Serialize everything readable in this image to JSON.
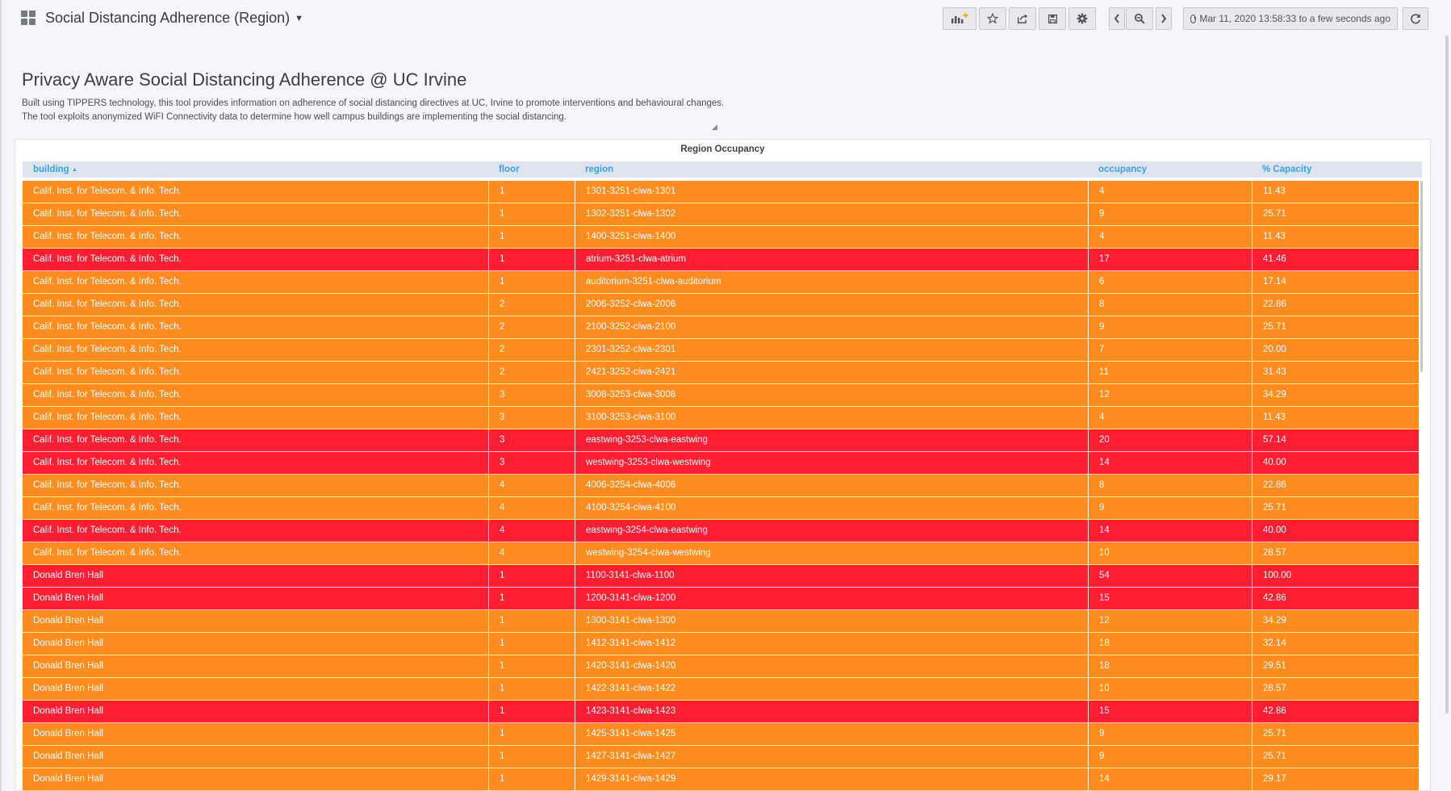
{
  "header": {
    "dashboard_title": "Social Distancing Adherence (Region)",
    "time_range": "Mar 11, 2020 13:58:33 to a few seconds ago",
    "icons": [
      "apps-grid-icon",
      "add-panel-icon",
      "star-icon",
      "share-icon",
      "save-icon",
      "settings-icon",
      "chevron-left-icon",
      "zoom-out-icon",
      "chevron-right-icon",
      "clock-icon",
      "refresh-icon"
    ]
  },
  "text_panel": {
    "heading": "Privacy Aware Social Distancing Adherence @ UC Irvine",
    "description": "Built using TIPPERS technology, this tool provides information on adherence of social distancing directives at UC, Irvine to promote interventions and behavioural changes. The tool exploits anonymized WiFI Connectivity data to determine how well campus buildings are implementing the social distancing."
  },
  "table": {
    "title": "Region Occupancy",
    "columns": [
      "building",
      "floor",
      "region",
      "occupancy",
      "% Capacity"
    ],
    "sort_indicator": "▲",
    "colors": {
      "orange": "#ff8c1e",
      "red": "#ff1e32",
      "header_text": "#33a2e5"
    },
    "rows": [
      {
        "building": "Calif. Inst. for Telecom. & Info. Tech.",
        "floor": "1",
        "region": "1301-3251-clwa-1301",
        "occupancy": "4",
        "capacity": "11.43",
        "status": "orange"
      },
      {
        "building": "Calif. Inst. for Telecom. & Info. Tech.",
        "floor": "1",
        "region": "1302-3251-clwa-1302",
        "occupancy": "9",
        "capacity": "25.71",
        "status": "orange"
      },
      {
        "building": "Calif. Inst. for Telecom. & Info. Tech.",
        "floor": "1",
        "region": "1400-3251-clwa-1400",
        "occupancy": "4",
        "capacity": "11.43",
        "status": "orange"
      },
      {
        "building": "Calif. Inst. for Telecom. & Info. Tech.",
        "floor": "1",
        "region": "atrium-3251-clwa-atrium",
        "occupancy": "17",
        "capacity": "41.46",
        "status": "red"
      },
      {
        "building": "Calif. Inst. for Telecom. & Info. Tech.",
        "floor": "1",
        "region": "auditorium-3251-clwa-auditorium",
        "occupancy": "6",
        "capacity": "17.14",
        "status": "orange"
      },
      {
        "building": "Calif. Inst. for Telecom. & Info. Tech.",
        "floor": "2",
        "region": "2006-3252-clwa-2006",
        "occupancy": "8",
        "capacity": "22.86",
        "status": "orange"
      },
      {
        "building": "Calif. Inst. for Telecom. & Info. Tech.",
        "floor": "2",
        "region": "2100-3252-clwa-2100",
        "occupancy": "9",
        "capacity": "25.71",
        "status": "orange"
      },
      {
        "building": "Calif. Inst. for Telecom. & Info. Tech.",
        "floor": "2",
        "region": "2301-3252-clwa-2301",
        "occupancy": "7",
        "capacity": "20.00",
        "status": "orange"
      },
      {
        "building": "Calif. Inst. for Telecom. & Info. Tech.",
        "floor": "2",
        "region": "2421-3252-clwa-2421",
        "occupancy": "11",
        "capacity": "31.43",
        "status": "orange"
      },
      {
        "building": "Calif. Inst. for Telecom. & Info. Tech.",
        "floor": "3",
        "region": "3008-3253-clwa-3008",
        "occupancy": "12",
        "capacity": "34.29",
        "status": "orange"
      },
      {
        "building": "Calif. Inst. for Telecom. & Info. Tech.",
        "floor": "3",
        "region": "3100-3253-clwa-3100",
        "occupancy": "4",
        "capacity": "11.43",
        "status": "orange"
      },
      {
        "building": "Calif. Inst. for Telecom. & Info. Tech.",
        "floor": "3",
        "region": "eastwing-3253-clwa-eastwing",
        "occupancy": "20",
        "capacity": "57.14",
        "status": "red"
      },
      {
        "building": "Calif. Inst. for Telecom. & Info. Tech.",
        "floor": "3",
        "region": "westwing-3253-clwa-westwing",
        "occupancy": "14",
        "capacity": "40.00",
        "status": "red"
      },
      {
        "building": "Calif. Inst. for Telecom. & Info. Tech.",
        "floor": "4",
        "region": "4006-3254-clwa-4006",
        "occupancy": "8",
        "capacity": "22.86",
        "status": "orange"
      },
      {
        "building": "Calif. Inst. for Telecom. & Info. Tech.",
        "floor": "4",
        "region": "4100-3254-clwa-4100",
        "occupancy": "9",
        "capacity": "25.71",
        "status": "orange"
      },
      {
        "building": "Calif. Inst. for Telecom. & Info. Tech.",
        "floor": "4",
        "region": "eastwing-3254-clwa-eastwing",
        "occupancy": "14",
        "capacity": "40.00",
        "status": "red"
      },
      {
        "building": "Calif. Inst. for Telecom. & Info. Tech.",
        "floor": "4",
        "region": "westwing-3254-clwa-westwing",
        "occupancy": "10",
        "capacity": "28.57",
        "status": "orange"
      },
      {
        "building": "Donald Bren Hall",
        "floor": "1",
        "region": "1100-3141-clwa-1100",
        "occupancy": "54",
        "capacity": "100.00",
        "status": "red"
      },
      {
        "building": "Donald Bren Hall",
        "floor": "1",
        "region": "1200-3141-clwa-1200",
        "occupancy": "15",
        "capacity": "42.86",
        "status": "red"
      },
      {
        "building": "Donald Bren Hall",
        "floor": "1",
        "region": "1300-3141-clwa-1300",
        "occupancy": "12",
        "capacity": "34.29",
        "status": "orange"
      },
      {
        "building": "Donald Bren Hall",
        "floor": "1",
        "region": "1412-3141-clwa-1412",
        "occupancy": "18",
        "capacity": "32.14",
        "status": "orange"
      },
      {
        "building": "Donald Bren Hall",
        "floor": "1",
        "region": "1420-3141-clwa-1420",
        "occupancy": "18",
        "capacity": "29.51",
        "status": "orange"
      },
      {
        "building": "Donald Bren Hall",
        "floor": "1",
        "region": "1422-3141-clwa-1422",
        "occupancy": "10",
        "capacity": "28.57",
        "status": "orange"
      },
      {
        "building": "Donald Bren Hall",
        "floor": "1",
        "region": "1423-3141-clwa-1423",
        "occupancy": "15",
        "capacity": "42.86",
        "status": "red"
      },
      {
        "building": "Donald Bren Hall",
        "floor": "1",
        "region": "1425-3141-clwa-1425",
        "occupancy": "9",
        "capacity": "25.71",
        "status": "orange"
      },
      {
        "building": "Donald Bren Hall",
        "floor": "1",
        "region": "1427-3141-clwa-1427",
        "occupancy": "9",
        "capacity": "25.71",
        "status": "orange"
      },
      {
        "building": "Donald Bren Hall",
        "floor": "1",
        "region": "1429-3141-clwa-1429",
        "occupancy": "14",
        "capacity": "29.17",
        "status": "orange"
      }
    ]
  }
}
